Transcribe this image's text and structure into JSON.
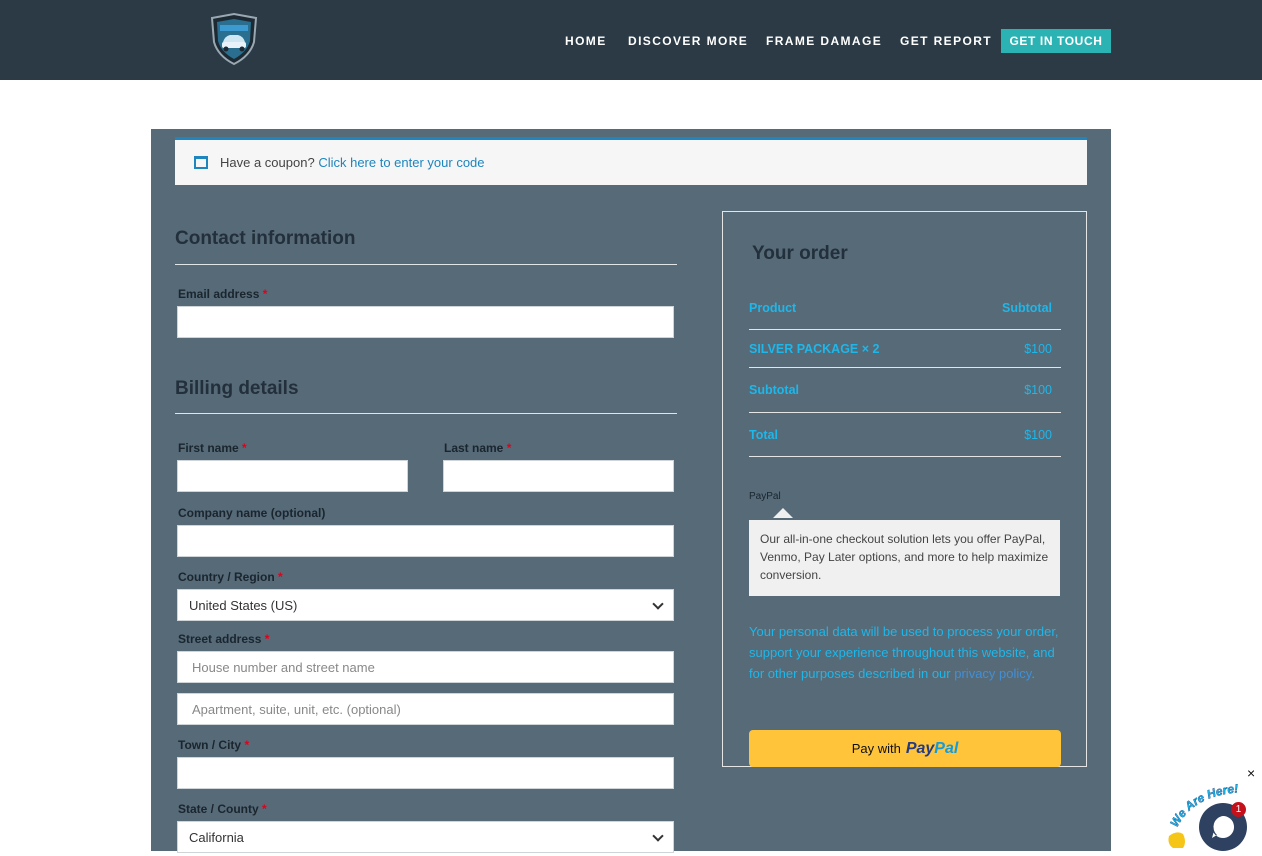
{
  "nav": {
    "items": [
      "HOME",
      "DISCOVER MORE",
      "FRAME DAMAGE",
      "GET REPORT"
    ],
    "cta": "GET IN TOUCH"
  },
  "coupon": {
    "prefix": "Have a coupon?",
    "link": "Click here to enter your code"
  },
  "contact": {
    "title": "Contact information",
    "email_label": "Email address"
  },
  "billing": {
    "title": "Billing details",
    "first_name_label": "First name",
    "last_name_label": "Last name",
    "company_label": "Company name (optional)",
    "country_label": "Country / Region",
    "country_value": "United States (US)",
    "street_label": "Street address",
    "street_placeholder": "House number and street name",
    "street2_placeholder": "Apartment, suite, unit, etc. (optional)",
    "city_label": "Town / City",
    "state_label": "State / County",
    "state_value": "California"
  },
  "order": {
    "title": "Your order",
    "header": {
      "product": "Product",
      "subtotal": "Subtotal"
    },
    "item": {
      "name": "SILVER PACKAGE",
      "qty": "× 2",
      "price": "$100"
    },
    "subtotal": {
      "label": "Subtotal",
      "value": "$100"
    },
    "total": {
      "label": "Total",
      "value": "$100"
    },
    "paypal_label": "PayPal",
    "paypal_desc": "Our all-in-one checkout solution lets you offer PayPal, Venmo, Pay Later options, and more to help maximize conversion.",
    "privacy_text": "Your personal data will be used to process your order, support your experience throughout this website, and for other purposes described in our",
    "privacy_link": "privacy policy",
    "privacy_end": ".",
    "pay_prefix": "Pay with",
    "pay_logo_a": "Pay",
    "pay_logo_b": "Pal"
  },
  "required_mark": "*",
  "chat": {
    "close": "×",
    "badge": "1",
    "tagline": "We Are Here!"
  },
  "colors": {
    "header_bg": "#2b3a45",
    "panel_bg": "#566a78",
    "accent": "#2bb3b3",
    "link": "#1eb7ea",
    "paypal": "#ffc439"
  }
}
